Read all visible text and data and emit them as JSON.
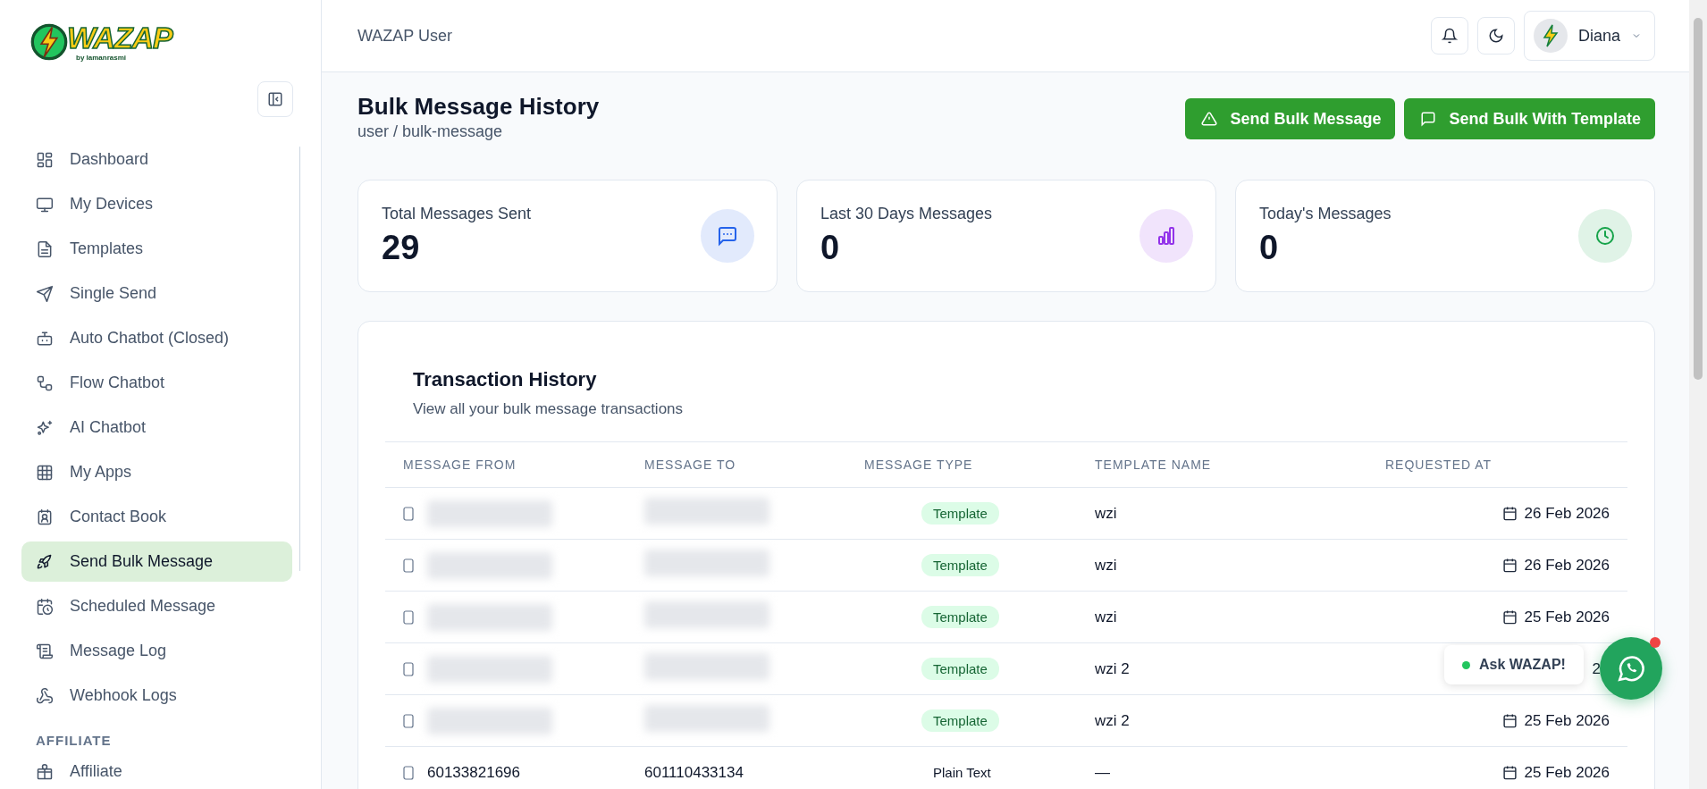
{
  "brand": {
    "logo_text": "WAZAP",
    "logo_sub": "by lamanrasmi"
  },
  "sidebar": {
    "items": [
      {
        "label": "Dashboard",
        "selected": false
      },
      {
        "label": "My Devices",
        "selected": false
      },
      {
        "label": "Templates",
        "selected": false
      },
      {
        "label": "Single Send",
        "selected": false
      },
      {
        "label": "Auto Chatbot (Closed)",
        "selected": false
      },
      {
        "label": "Flow Chatbot",
        "selected": false
      },
      {
        "label": "AI Chatbot",
        "selected": false
      },
      {
        "label": "My Apps",
        "selected": false
      },
      {
        "label": "Contact Book",
        "selected": false
      },
      {
        "label": "Send Bulk Message",
        "selected": true
      },
      {
        "label": "Scheduled Message",
        "selected": false
      },
      {
        "label": "Message Log",
        "selected": false
      },
      {
        "label": "Webhook Logs",
        "selected": false
      }
    ],
    "section": "AFFILIATE",
    "section_items": [
      {
        "label": "Affiliate",
        "selected": false
      }
    ]
  },
  "header": {
    "title": "WAZAP User",
    "user": "Diana"
  },
  "page": {
    "title": "Bulk Message History",
    "breadcrumb": "user / bulk-message",
    "buttons": [
      {
        "label": "Send Bulk Message"
      },
      {
        "label": "Send Bulk With Template"
      }
    ]
  },
  "stats": [
    {
      "label": "Total Messages Sent",
      "value": "29",
      "color": "#2563eb"
    },
    {
      "label": "Last 30 Days Messages",
      "value": "0",
      "color": "#9333ea"
    },
    {
      "label": "Today's Messages",
      "value": "0",
      "color": "#16a34a"
    }
  ],
  "table": {
    "title": "Transaction History",
    "subtitle": "View all your bulk message transactions",
    "columns": [
      "MESSAGE FROM",
      "MESSAGE TO",
      "MESSAGE TYPE",
      "TEMPLATE NAME",
      "REQUESTED AT"
    ],
    "rows": [
      {
        "from": null,
        "to": null,
        "type": "Template",
        "kind": "template",
        "template": "wzi",
        "date": "26 Feb 2026",
        "date_covered": false
      },
      {
        "from": null,
        "to": null,
        "type": "Template",
        "kind": "template",
        "template": "wzi",
        "date": "26 Feb 2026",
        "date_covered": false
      },
      {
        "from": null,
        "to": null,
        "type": "Template",
        "kind": "template",
        "template": "wzi",
        "date": "25 Feb 2026",
        "date_covered": false
      },
      {
        "from": null,
        "to": null,
        "type": "Template",
        "kind": "template",
        "template": "wzi 2",
        "date": "2",
        "date_covered": true
      },
      {
        "from": null,
        "to": null,
        "type": "Template",
        "kind": "template",
        "template": "wzi 2",
        "date": "25 Feb 2026",
        "date_covered": false
      },
      {
        "from": "60133821696",
        "to": "601110433134",
        "type": "Plain Text",
        "kind": "plain",
        "template": "—",
        "date": "25 Feb 2026",
        "date_covered": false
      }
    ]
  },
  "chat_widget": {
    "label": "Ask WAZAP!"
  }
}
